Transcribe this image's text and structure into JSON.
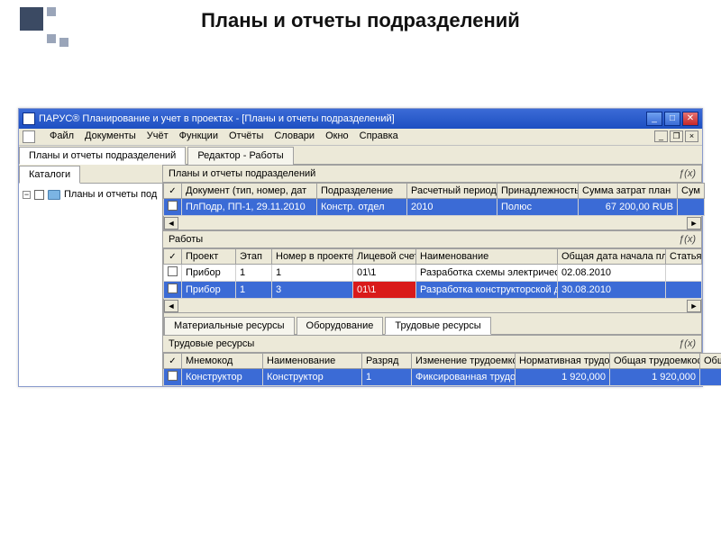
{
  "slide_title": "Планы и отчеты подразделений",
  "window": {
    "title": "ПАРУС® Планирование и учет в проектах - [Планы и отчеты подразделений]"
  },
  "menubar": [
    "Файл",
    "Документы",
    "Учёт",
    "Функции",
    "Отчёты",
    "Словари",
    "Окно",
    "Справка"
  ],
  "top_tabs": {
    "t1": "Планы и отчеты подразделений",
    "t2": "Редактор - Работы"
  },
  "left": {
    "tab": "Каталоги",
    "tree_root": "Планы и отчеты под"
  },
  "section1": {
    "title": "Планы и отчеты подразделений",
    "fn_label": "ƒ(x)",
    "cols": {
      "c0": "✓",
      "c1": "Документ (тип, номер, дат",
      "c2": "Подразделение",
      "c3": "Расчетный период",
      "c4": "Принадлежность",
      "c5": "Сумма затрат план",
      "c6": "Сум"
    },
    "row": {
      "c1": "ПлПодр, ПП-1, 29.11.2010",
      "c2": "Констр. отдел",
      "c3": "2010",
      "c4": "Полюс",
      "c5": "67 200,00 RUB",
      "c6": ""
    }
  },
  "section2": {
    "title": "Работы",
    "fn_label": "ƒ(x)",
    "cols": {
      "c0": "✓",
      "c1": "Проект",
      "c2": "Этап",
      "c3": "Номер в проекте",
      "c4": "Лицевой счет",
      "c5": "Наименование",
      "c6": "Общая дата начала план",
      "c7": "Статья"
    },
    "rows": [
      {
        "c1": "Прибор",
        "c2": "1",
        "c3": "1",
        "c4": "01\\1",
        "c5": "Разработка схемы электрической прибора",
        "c6": "02.08.2010",
        "c7": ""
      },
      {
        "c1": "Прибор",
        "c2": "1",
        "c3": "3",
        "c4": "01\\1",
        "c5": "Разработка конструкторской документации прибора",
        "c6": "30.08.2010",
        "c7": ""
      }
    ]
  },
  "sub_tabs": {
    "t1": "Материальные ресурсы",
    "t2": "Оборудование",
    "t3": "Трудовые ресурсы"
  },
  "section3": {
    "title": "Трудовые ресурсы",
    "fn_label": "ƒ(x)",
    "cols": {
      "c0": "✓",
      "c1": "Мнемокод",
      "c2": "Наименование",
      "c3": "Разряд",
      "c4": "Изменение трудоемко",
      "c5": "Нормативная трудоем",
      "c6": "Общая трудоемкость",
      "c7": "Обще"
    },
    "row": {
      "c1": "Конструктор",
      "c2": "Конструктор",
      "c3": "1",
      "c4": "Фиксированная трудо",
      "c5": "1 920,000",
      "c6": "1 920,000",
      "c7": ""
    }
  }
}
